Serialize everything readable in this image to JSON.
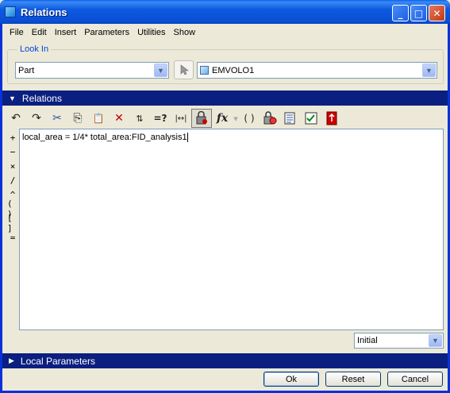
{
  "window": {
    "title": "Relations"
  },
  "titlebar_buttons": {
    "minimize": "_",
    "maximize": "□",
    "close": "✕"
  },
  "menu": [
    "File",
    "Edit",
    "Insert",
    "Parameters",
    "Utilities",
    "Show"
  ],
  "look_in": {
    "label": "Look In",
    "type_value": "Part",
    "model_value": "EMVOLO1"
  },
  "relations_section": {
    "label": "Relations"
  },
  "toolbar_icons": [
    "undo-icon",
    "redo-icon",
    "cut-icon",
    "copy-icon",
    "paste-icon",
    "delete-icon",
    "sort-relations-icon",
    "evaluate-icon",
    "measure-icon",
    "display-parameter-icon",
    "function-icon",
    "parenthesis-icon",
    "lock-icon",
    "details-icon",
    "verify-icon",
    "import-icon"
  ],
  "toolbar_glyphs": {
    "undo": "↶",
    "redo": "↷",
    "cut": "✂",
    "copy": "⎘",
    "paste": "📋",
    "delete": "✕",
    "sort": "⇅",
    "evaluate": "=?",
    "measure": "|↔|",
    "fx": "fx",
    "paren": "( )"
  },
  "operators": [
    "+",
    "−",
    "×",
    "/",
    "^",
    "( )",
    "[ ]",
    "="
  ],
  "editor": {
    "text": "local_area = 1/4* total_area:FID_analysis1"
  },
  "sort_combo": {
    "value": "Initial"
  },
  "local_params_section": {
    "label": "Local Parameters"
  },
  "buttons": {
    "ok": "Ok",
    "reset": "Reset",
    "cancel": "Cancel"
  },
  "colors": {
    "section_header": "#0a1f7f",
    "title_bar": "#0a4fd4",
    "face": "#ece9d8"
  }
}
